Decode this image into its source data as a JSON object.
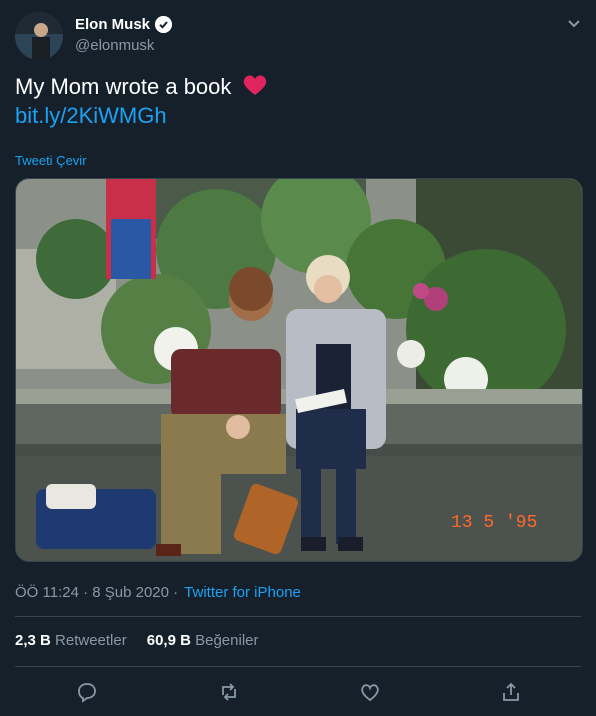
{
  "author": {
    "name": "Elon Musk",
    "handle": "@elonmusk"
  },
  "tweet": {
    "text": "My Mom wrote a book",
    "link": "bit.ly/2KiWMGh"
  },
  "translate_label": "Tweeti Çevir",
  "photo": {
    "date_stamp": "13 5 '95"
  },
  "meta": {
    "time": "ÖÖ 11:24 · 8 Şub 2020 ·",
    "source": "Twitter for iPhone"
  },
  "stats": {
    "retweets_count": "2,3 B",
    "retweets_label": "Retweetler",
    "likes_count": "60,9 B",
    "likes_label": "Beğeniler"
  },
  "colors": {
    "background": "#15202b",
    "accent": "#1da1f2",
    "heart": "#e0245e",
    "muted": "#8899a6"
  }
}
